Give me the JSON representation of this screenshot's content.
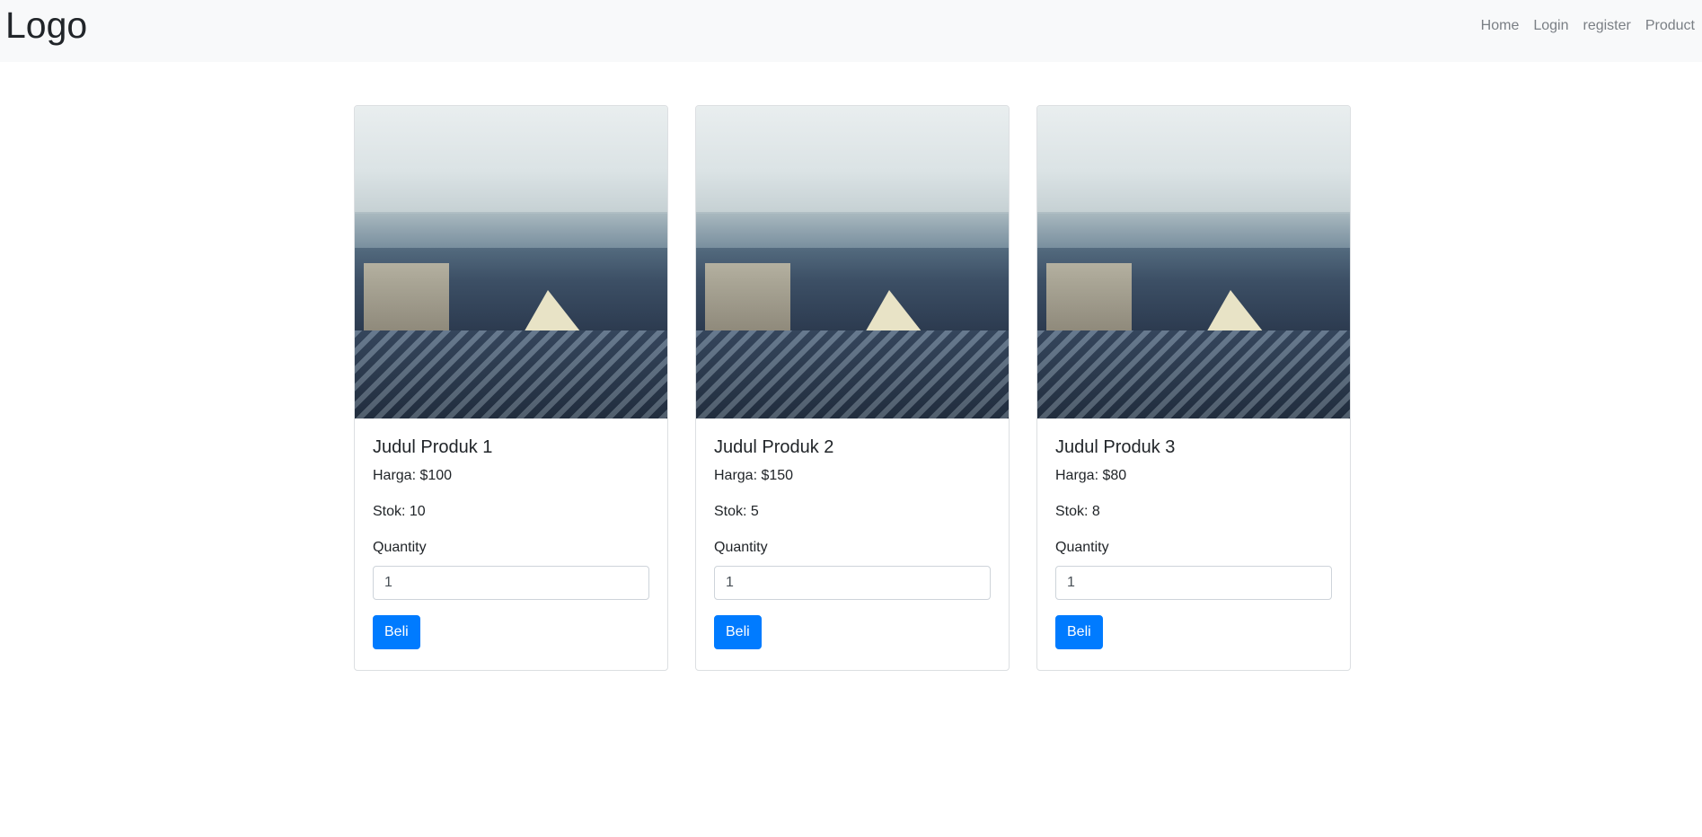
{
  "navbar": {
    "brand": "Logo",
    "links": [
      {
        "label": "Home"
      },
      {
        "label": "Login"
      },
      {
        "label": "register"
      },
      {
        "label": "Product"
      }
    ]
  },
  "products": [
    {
      "title": "Judul Produk 1",
      "price": "Harga: $100",
      "stock": "Stok: 10",
      "quantity_label": "Quantity",
      "quantity_value": "1",
      "buy_label": "Beli"
    },
    {
      "title": "Judul Produk 2",
      "price": "Harga: $150",
      "stock": "Stok: 5",
      "quantity_label": "Quantity",
      "quantity_value": "1",
      "buy_label": "Beli"
    },
    {
      "title": "Judul Produk 3",
      "price": "Harga: $80",
      "stock": "Stok: 8",
      "quantity_label": "Quantity",
      "quantity_value": "1",
      "buy_label": "Beli"
    }
  ],
  "colors": {
    "navbar_bg": "#f8f9fa",
    "primary": "#007bff",
    "nav_link": "#7a7f85"
  }
}
